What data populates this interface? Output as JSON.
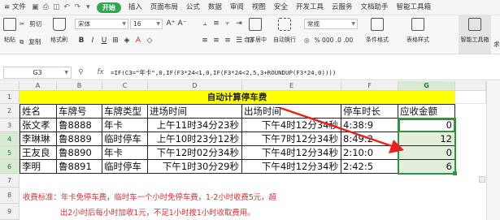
{
  "menu": {
    "file": "≡ 文件",
    "start": "开始",
    "items": [
      "插入",
      "页面布局",
      "公式",
      "数据",
      "审阅",
      "视图",
      "安全",
      "开发工具",
      "云服务",
      "文档助手",
      "智能工具箱"
    ]
  },
  "ribbon": {
    "paste": "粘贴",
    "cut": "剪切",
    "copy": "复制",
    "format_painter": "格式刷",
    "font_name": "宋体",
    "font_size": "16",
    "merge": "合并居中",
    "wrap": "自动换行",
    "number_format": "常规",
    "percent_row": "% 000 .0 .00",
    "cond_format": "条件格式",
    "table_style": "表格样式",
    "smart_tools": "智能工具箱",
    "more": "求"
  },
  "formula_bar": {
    "cell_ref": "G3",
    "formula": "=IF(C3=\"年卡\",0,IF(F3*24<1,0,IF(F3*24<2,5,3+ROUNDUP(F3*24,0))))"
  },
  "columns": [
    "A",
    "B",
    "C",
    "D",
    "E",
    "F",
    "G"
  ],
  "rows": [
    "1",
    "2",
    "3",
    "4",
    "5",
    "6",
    "7",
    "8",
    "9"
  ],
  "sheet": {
    "title": "自动计算停车费",
    "headers": [
      "姓名",
      "车牌号",
      "车牌类型",
      "进场时间",
      "出场时间",
      "停车时长",
      "应收金额"
    ],
    "data": [
      [
        "张文孝",
        "鲁8888",
        "年卡",
        "上午11时34分23秒",
        "下午4时12分34秒",
        "4:38:9",
        "0"
      ],
      [
        "李琳琳",
        "鲁8889",
        "临时停车",
        "上午10时23分12秒",
        "下午7时12分34秒",
        "8:49:2",
        "12"
      ],
      [
        "王友良",
        "鲁8890",
        "年卡",
        "下午12时02分34秒",
        "下午4时12分34秒",
        "2:10:0",
        "0"
      ],
      [
        "李明",
        "鲁8891",
        "临时停车",
        "下午1时30分29秒",
        "下午4时12分34秒",
        "2:42:5",
        "6"
      ]
    ],
    "note_line1": "收费标准：年卡免停车费，临时车一个小时免停车费，1-2小时收费5元，超",
    "note_line2": "出2小时后每小时加收1元，不足1小时按1小时收取费用。"
  },
  "colors": {
    "title_fill": "#ffff00",
    "selection_fill": "#e2efda",
    "selection_border": "#2e9445",
    "arrow": "#e8231f",
    "note_text": "#e03030",
    "start_tab": "#2fa84f"
  }
}
